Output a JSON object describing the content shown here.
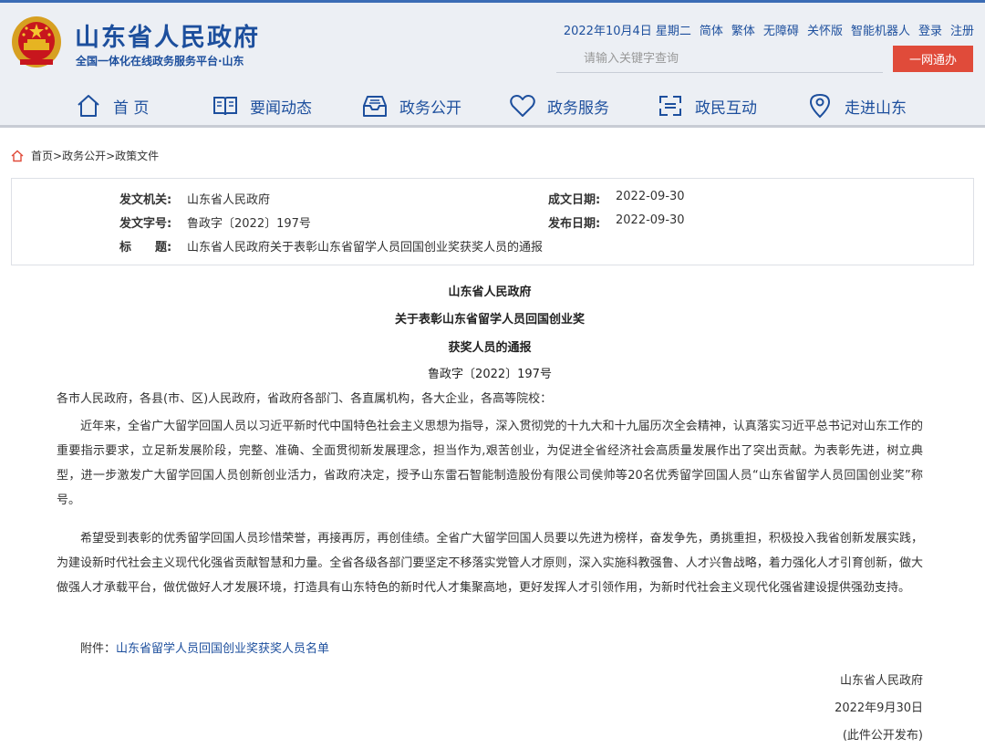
{
  "header": {
    "site_title": "山东省人民政府",
    "site_subtitle": "全国一体化在线政务服务平台·山东",
    "date": "2022年10月4日 星期二",
    "links": [
      "简体",
      "繁体",
      "无障碍",
      "关怀版",
      "智能机器人",
      "登录",
      "注册"
    ],
    "search_placeholder": "请输入关键字查询",
    "search_button": "一网通办"
  },
  "nav": [
    {
      "label": "首 页",
      "icon": "home-icon"
    },
    {
      "label": "要闻动态",
      "icon": "book-icon"
    },
    {
      "label": "政务公开",
      "icon": "inbox-icon"
    },
    {
      "label": "政务服务",
      "icon": "heart-icon"
    },
    {
      "label": "政民互动",
      "icon": "interact-icon"
    },
    {
      "label": "走进山东",
      "icon": "location-icon"
    }
  ],
  "breadcrumb": [
    "首页",
    "政务公开",
    "政策文件"
  ],
  "meta": {
    "issuer_label": "发文机关:",
    "issuer": "山东省人民政府",
    "created_label": "成文日期:",
    "created": "2022-09-30",
    "doc_no_label": "发文字号:",
    "doc_no": "鲁政字〔2022〕197号",
    "published_label": "发布日期:",
    "published": "2022-09-30",
    "title_label": "标　　题:",
    "title": "山东省人民政府关于表彰山东省留学人员回国创业奖获奖人员的通报"
  },
  "article": {
    "title_line1": "山东省人民政府",
    "title_line2": "关于表彰山东省留学人员回国创业奖",
    "title_line3": "获奖人员的通报",
    "doc_no": "鲁政字〔2022〕197号",
    "salutation": "各市人民政府，各县(市、区)人民政府，省政府各部门、各直属机构，各大企业，各高等院校：",
    "para1": "近年来，全省广大留学回国人员以习近平新时代中国特色社会主义思想为指导，深入贯彻党的十九大和十九届历次全会精神，认真落实习近平总书记对山东工作的重要指示要求，立足新发展阶段，完整、准确、全面贯彻新发展理念，担当作为,艰苦创业，为促进全省经济社会高质量发展作出了突出贡献。为表彰先进，树立典型，进一步激发广大留学回国人员创新创业活力，省政府决定，授予山东雷石智能制造股份有限公司侯帅等20名优秀留学回国人员“山东省留学人员回国创业奖”称号。",
    "para2": "希望受到表彰的优秀留学回国人员珍惜荣誉，再接再厉，再创佳绩。全省广大留学回国人员要以先进为榜样，奋发争先，勇挑重担，积极投入我省创新发展实践，为建设新时代社会主义现代化强省贡献智慧和力量。全省各级各部门要坚定不移落实党管人才原则，深入实施科教强鲁、人才兴鲁战略，着力强化人才引育创新，做大做强人才承载平台，做优做好人才发展环境，打造具有山东特色的新时代人才集聚高地，更好发挥人才引领作用，为新时代社会主义现代化强省建设提供强劲支持。",
    "attachment_label": "附件：",
    "attachment_link": "山东省留学人员回国创业奖获奖人员名单",
    "sign_org": "山东省人民政府",
    "sign_date": "2022年9月30日",
    "sign_note": "(此件公开发布)"
  },
  "colors": {
    "brand": "#1d4f9d",
    "accent": "#e04b3a",
    "header_bg": "#eceff4"
  }
}
